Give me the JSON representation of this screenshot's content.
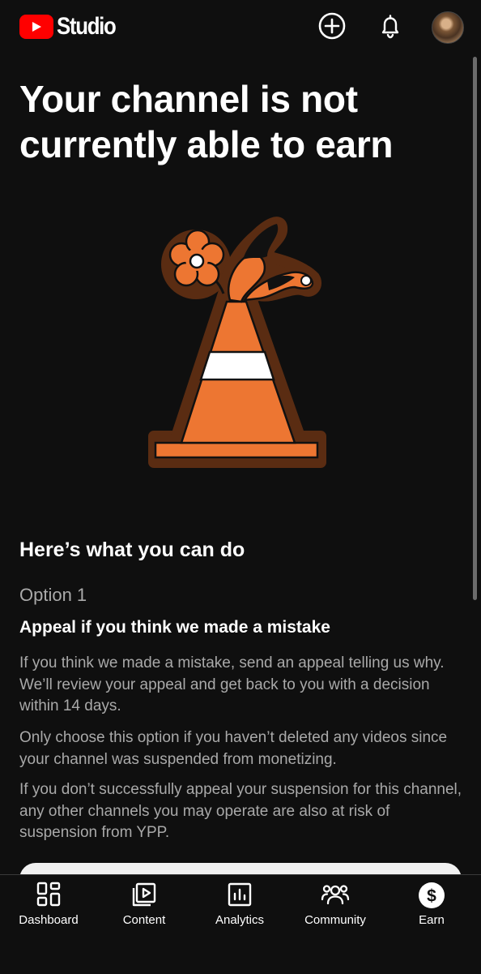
{
  "header": {
    "app_title": "Studio",
    "icons": [
      "youtube-logo-icon",
      "create-plus-icon",
      "notifications-bell-icon",
      "avatar"
    ]
  },
  "main": {
    "headline": "Your channel is not currently able to earn",
    "illustration": "traffic-cone-with-flower-illustration",
    "section_title": "Here’s what you can do",
    "option_label": "Option 1",
    "option_title": "Appeal if you think we made a mistake",
    "paragraphs": [
      "If you think we made a mistake, send an appeal telling us why. We’ll review your appeal and get back to you with a decision within 14 days.",
      "Only choose this option if you haven’t deleted any videos since your channel was suspended from monetizing.",
      "If you don’t successfully appeal your suspension for this channel, any other channels you may operate are also at risk of suspension from YPP."
    ]
  },
  "bottom_nav": {
    "items": [
      {
        "label": "Dashboard",
        "icon": "dashboard-icon"
      },
      {
        "label": "Content",
        "icon": "content-play-icon"
      },
      {
        "label": "Analytics",
        "icon": "analytics-chart-icon"
      },
      {
        "label": "Community",
        "icon": "community-people-icon"
      },
      {
        "label": "Earn",
        "icon": "earn-dollar-icon"
      }
    ]
  },
  "colors": {
    "background": "#0f0f0f",
    "brand_red": "#ff0000",
    "cone_orange": "#ed7632",
    "cone_outline": "#5a2c12",
    "muted_text": "#aaaaaa"
  }
}
